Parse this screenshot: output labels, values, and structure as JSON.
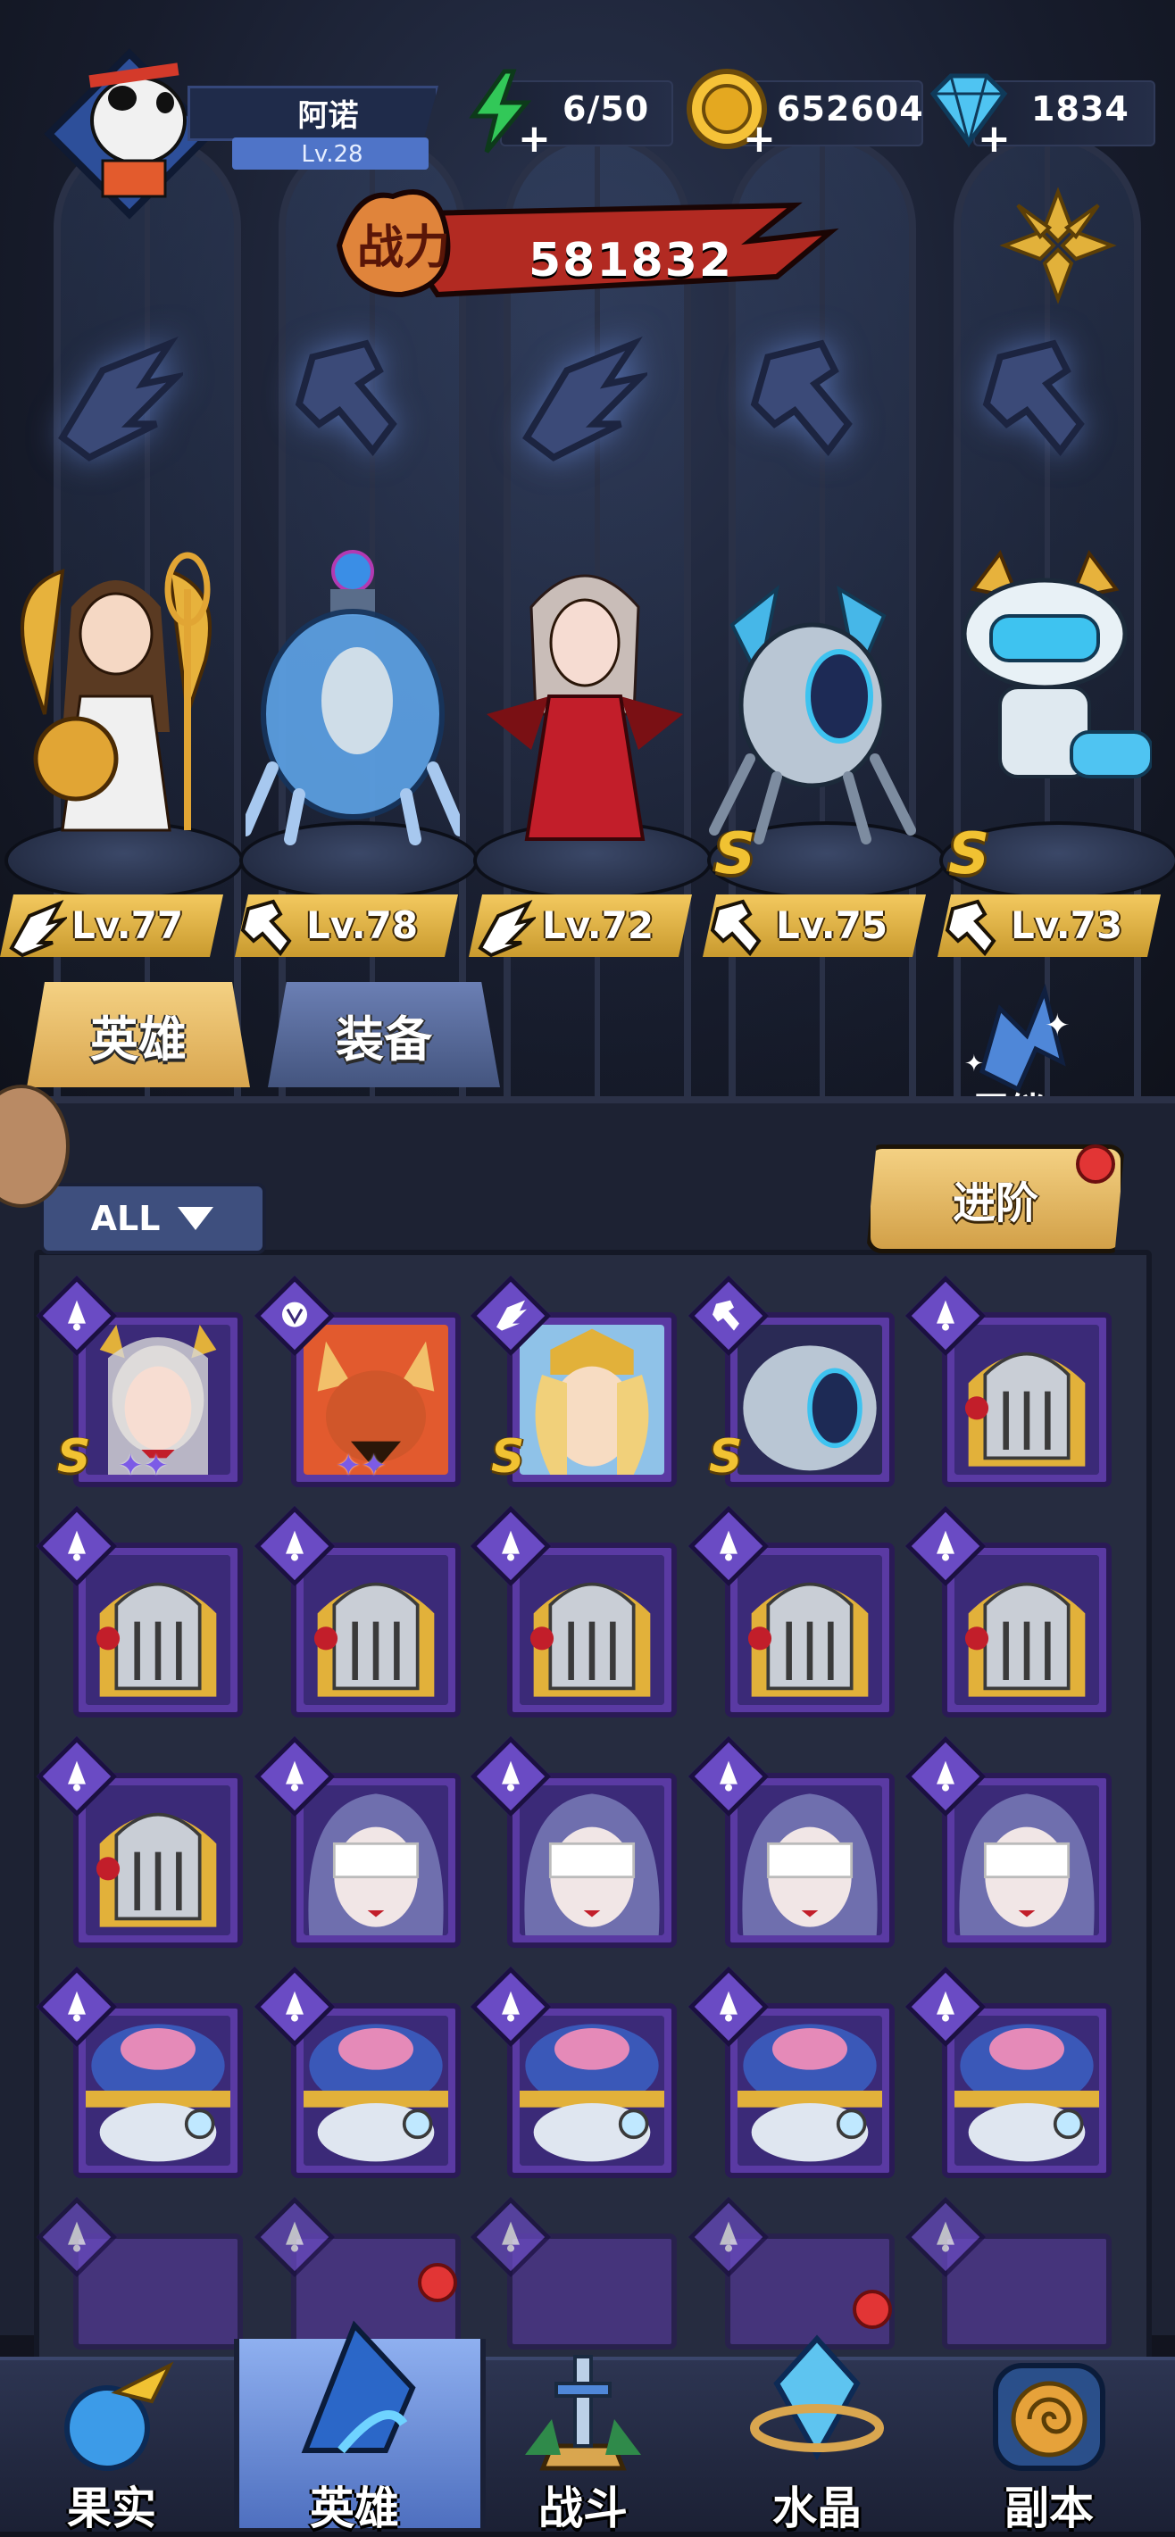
{
  "player": {
    "name": "阿诺",
    "level": "Lv.28"
  },
  "resources": {
    "stamina": "6/50",
    "gold": "652604",
    "diamonds": "1834"
  },
  "power": {
    "label": "战力",
    "value": "581832"
  },
  "lineup": [
    {
      "level": "Lv.77",
      "class_icon": "wing-icon",
      "s_rank": false
    },
    {
      "level": "Lv.78",
      "class_icon": "wrench-icon",
      "s_rank": false
    },
    {
      "level": "Lv.72",
      "class_icon": "wing-icon",
      "s_rank": false
    },
    {
      "level": "Lv.75",
      "class_icon": "wrench-icon",
      "s_rank": true,
      "s_label": "S"
    },
    {
      "level": "Lv.73",
      "class_icon": "wrench-icon",
      "s_rank": true,
      "s_label": "S"
    }
  ],
  "tabs": {
    "heroes": "英雄",
    "equipment": "装备"
  },
  "bond": {
    "label": "羁绊"
  },
  "filter": {
    "label": "ALL"
  },
  "advance": {
    "label": "进阶"
  },
  "grid": {
    "rows": [
      [
        {
          "portrait": "horned-queen",
          "class_icon": "bell-icon",
          "s": "S",
          "stars": "✦✦"
        },
        {
          "portrait": "fox-beast",
          "class_icon": "claw-icon",
          "s": "",
          "stars": "✦✦"
        },
        {
          "portrait": "golden-prince",
          "class_icon": "wing-icon",
          "s": "S",
          "stars": ""
        },
        {
          "portrait": "mech-spider",
          "class_icon": "wrench-icon",
          "s": "S",
          "stars": ""
        },
        {
          "portrait": "knight-helm",
          "class_icon": "bell-icon",
          "s": "",
          "stars": ""
        }
      ],
      [
        {
          "portrait": "knight-helm",
          "class_icon": "bell-icon"
        },
        {
          "portrait": "knight-helm",
          "class_icon": "bell-icon"
        },
        {
          "portrait": "knight-helm",
          "class_icon": "bell-icon"
        },
        {
          "portrait": "knight-helm",
          "class_icon": "bell-icon"
        },
        {
          "portrait": "knight-helm",
          "class_icon": "bell-icon"
        }
      ],
      [
        {
          "portrait": "knight-helm",
          "class_icon": "bell-icon"
        },
        {
          "portrait": "blindfold-nun",
          "class_icon": "bell-icon"
        },
        {
          "portrait": "blindfold-nun",
          "class_icon": "bell-icon"
        },
        {
          "portrait": "blindfold-nun",
          "class_icon": "bell-icon"
        },
        {
          "portrait": "blindfold-nun",
          "class_icon": "bell-icon"
        }
      ],
      [
        {
          "portrait": "brain-wizard",
          "class_icon": "bell-icon"
        },
        {
          "portrait": "brain-wizard",
          "class_icon": "bell-icon"
        },
        {
          "portrait": "brain-wizard",
          "class_icon": "bell-icon"
        },
        {
          "portrait": "brain-wizard",
          "class_icon": "bell-icon"
        },
        {
          "portrait": "brain-wizard",
          "class_icon": "bell-icon"
        }
      ]
    ]
  },
  "nav": {
    "fruit": "果实",
    "heroes": "英雄",
    "battle": "战斗",
    "crystal": "水晶",
    "dungeon": "副本"
  },
  "colors": {
    "gold": "#f1c232",
    "card_purple": "#5a3aa3",
    "tab_active": "#f4d183",
    "notification": "#e23535"
  }
}
